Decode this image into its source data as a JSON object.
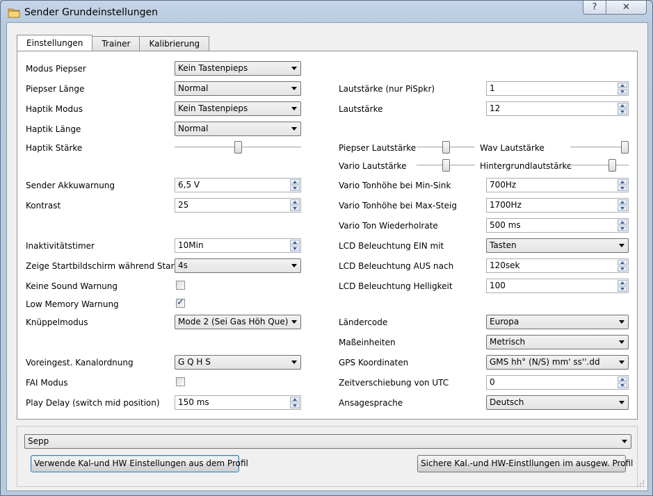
{
  "window": {
    "title": "Sender Grundeinstellungen",
    "help_glyph": "?",
    "close_glyph": "✕"
  },
  "tabs": [
    {
      "label": "Einstellungen",
      "active": true
    },
    {
      "label": "Trainer",
      "active": false
    },
    {
      "label": "Kalibrierung",
      "active": false
    }
  ],
  "left": {
    "modus_piepser": {
      "label": "Modus Piepser",
      "value": "Kein Tastenpieps"
    },
    "piepser_laenge": {
      "label": "Piepser Länge",
      "value": "Normal"
    },
    "haptik_modus": {
      "label": "Haptik Modus",
      "value": "Kein Tastenpieps"
    },
    "haptik_laenge": {
      "label": "Haptik Länge",
      "value": "Normal"
    },
    "haptik_staerke": {
      "label": "Haptik Stärke",
      "level": 0.5
    },
    "akkuwarnung": {
      "label": "Sender Akkuwarnung",
      "value": "6,5 V"
    },
    "kontrast": {
      "label": "Kontrast",
      "value": "25"
    },
    "inaktivitaet": {
      "label": "Inaktivitätstimer",
      "value": "10Min"
    },
    "startbild": {
      "label": "Zeige Startbildschirm während Start",
      "value": "4s"
    },
    "keine_sound": {
      "label": "Keine Sound Warnung",
      "checked": false
    },
    "low_memory": {
      "label": "Low Memory Warnung",
      "checked": true
    },
    "knueppelmodus": {
      "label": "Knüppelmodus",
      "value": "Mode 2 (Sei Gas Höh Que)"
    },
    "kanalordnung": {
      "label": "Voreingest. Kanalordnung",
      "value": "G Q H S"
    },
    "fai": {
      "label": "FAI Modus",
      "checked": false
    },
    "play_delay": {
      "label": "Play Delay (switch mid position)",
      "value": "150 ms"
    }
  },
  "right": {
    "lautstaerke_pispkr": {
      "label": "Lautstärke (nur PiSpkr)",
      "value": "1"
    },
    "lautstaerke": {
      "label": "Lautstärke",
      "value": "12"
    },
    "piepser_lautstaerke": {
      "label": "Piepser Lautstärke",
      "level": 0.5
    },
    "wav_lautstaerke": {
      "label": "Wav Lautstärke",
      "level": 1.0
    },
    "vario_lautstaerke": {
      "label": "Vario Lautstärke",
      "level": 0.5
    },
    "hintergrund": {
      "label": "Hintergrundlautstärke",
      "level": 0.75
    },
    "vario_min_sink": {
      "label": "Vario Tonhöhe bei Min-Sink",
      "value": "700Hz"
    },
    "vario_max_steig": {
      "label": "Vario Tonhöhe bei Max-Steig",
      "value": "1700Hz"
    },
    "vario_wiederhol": {
      "label": "Vario Ton Wiederholrate",
      "value": "500 ms"
    },
    "lcd_ein": {
      "label": "LCD Beleuchtung EIN mit",
      "value": "Tasten"
    },
    "lcd_aus": {
      "label": "LCD Beleuchtung AUS nach",
      "value": "120sek"
    },
    "lcd_hell": {
      "label": "LCD Beleuchtung Helligkeit",
      "value": "100"
    },
    "laendercode": {
      "label": "Ländercode",
      "value": "Europa"
    },
    "masseinheiten": {
      "label": "Maßeinheiten",
      "value": "Metrisch"
    },
    "gps": {
      "label": "GPS Koordinaten",
      "value": "GMS hh° (N/S) mm' ss''.dd"
    },
    "utc": {
      "label": "Zeitverschiebung von UTC",
      "value": "0"
    },
    "ansage": {
      "label": "Ansagesprache",
      "value": "Deutsch"
    }
  },
  "bottom": {
    "profile": "Sepp",
    "use_button": "Verwende Kal-und HW Einstellungen aus dem Profil",
    "save_button": "Sichere Kal.-und HW-Einstllungen im ausgew. Profil"
  }
}
